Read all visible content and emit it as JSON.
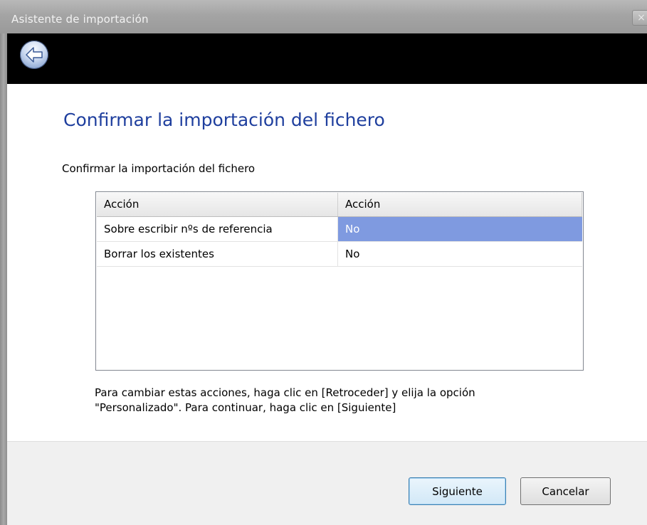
{
  "window": {
    "title": "Asistente de importación",
    "close_label": "×"
  },
  "nav": {
    "back_icon": "back-arrow-icon"
  },
  "page": {
    "heading": "Confirmar la importación del fichero",
    "subheading": "Confirmar la importación del fichero"
  },
  "grid": {
    "columns": [
      "Acción",
      "Acción"
    ],
    "rows": [
      {
        "name": "Sobre escribir nºs de referencia",
        "value": "No",
        "selected": true
      },
      {
        "name": "Borrar los existentes",
        "value": "No",
        "selected": false
      }
    ]
  },
  "instructions": {
    "line1": "Para cambiar estas acciones, haga clic en [Retroceder] y elija la opción",
    "line2": "\"Personalizado\". Para continuar, haga clic en [Siguiente]"
  },
  "buttons": {
    "next": "Siguiente",
    "cancel": "Cancelar"
  },
  "colors": {
    "heading": "#1f3f9e",
    "selection": "#7f9ae0",
    "navbar": "#000000"
  }
}
